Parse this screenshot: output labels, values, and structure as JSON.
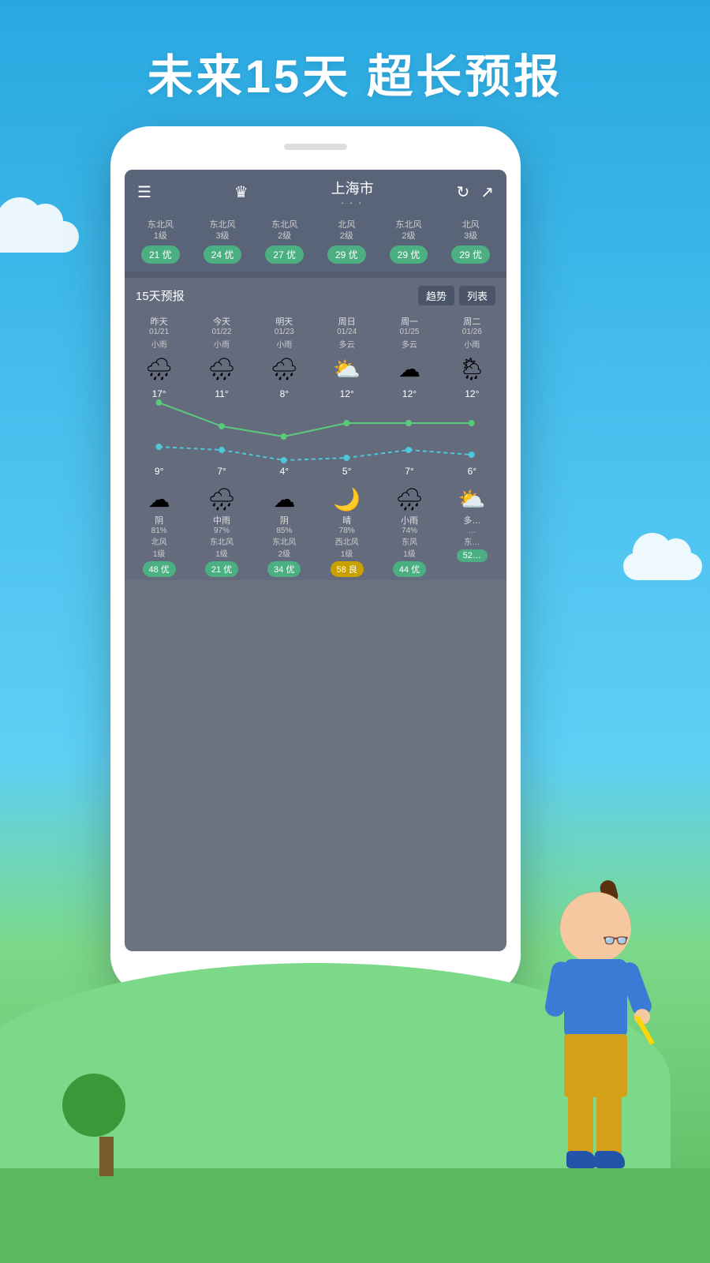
{
  "headline": "未来15天  超长预报",
  "background": {
    "sky_top": "#29a8e0",
    "sky_bottom": "#5dd0f5",
    "grass": "#5cb85c"
  },
  "phone": {
    "header": {
      "menu_icon": "☰",
      "crown_icon": "♛",
      "title": "上海市",
      "dots": "• • •",
      "refresh_icon": "↻",
      "share_icon": "↗"
    },
    "aqi_row": [
      {
        "wind": "东北风\n1级",
        "badge": "21 优"
      },
      {
        "wind": "东北风\n3级",
        "badge": "24 优"
      },
      {
        "wind": "东北风\n2级",
        "badge": "27 优"
      },
      {
        "wind": "北风\n2级",
        "badge": "29 优"
      },
      {
        "wind": "东北风\n2级",
        "badge": "29 优"
      },
      {
        "wind": "北风\n3级",
        "badge": "29 优"
      }
    ],
    "forecast_section": {
      "title": "15天预报",
      "tab_trend": "趋势",
      "tab_list": "列表"
    },
    "days": [
      {
        "name": "昨天",
        "date": "01/21",
        "weather": "小雨",
        "icon": "🌧",
        "high": "17°",
        "low": "9°"
      },
      {
        "name": "今天",
        "date": "01/22",
        "weather": "小雨",
        "icon": "🌧",
        "high": "11°",
        "low": "7°"
      },
      {
        "name": "明天",
        "date": "01/23",
        "weather": "小雨",
        "icon": "🌧",
        "high": "8°",
        "low": "4°"
      },
      {
        "name": "周日",
        "date": "01/24",
        "weather": "多云",
        "icon": "⛅",
        "high": "12°",
        "low": "5°"
      },
      {
        "name": "周一",
        "date": "01/25",
        "weather": "多云",
        "icon": "☁",
        "high": "12°",
        "low": "7°"
      },
      {
        "name": "周二",
        "date": "01/26",
        "weather": "小雨",
        "icon": "🌦",
        "high": "12°",
        "low": "6°"
      }
    ],
    "bottom_days": [
      {
        "icon": "☁",
        "name": "阴",
        "percent": "81%",
        "wind": "北风\n1级",
        "badge": "48 优",
        "badge_type": "green"
      },
      {
        "icon": "🌧",
        "name": "中雨",
        "percent": "97%",
        "wind": "东北风\n1级",
        "badge": "21 优",
        "badge_type": "green"
      },
      {
        "icon": "☁",
        "name": "阴",
        "percent": "85%",
        "wind": "东北风\n2级",
        "badge": "34 优",
        "badge_type": "green"
      },
      {
        "icon": "🌙",
        "name": "晴",
        "percent": "78%",
        "wind": "西北风\n1级",
        "badge": "58 良",
        "badge_type": "yellow"
      },
      {
        "icon": "🌧",
        "name": "小雨",
        "percent": "74%",
        "wind": "东风\n1级",
        "badge": "44 优",
        "badge_type": "green"
      },
      {
        "icon": "⛅",
        "name": "多…",
        "percent": "…",
        "wind": "东…",
        "badge": "52…",
        "badge_type": "green"
      }
    ]
  }
}
